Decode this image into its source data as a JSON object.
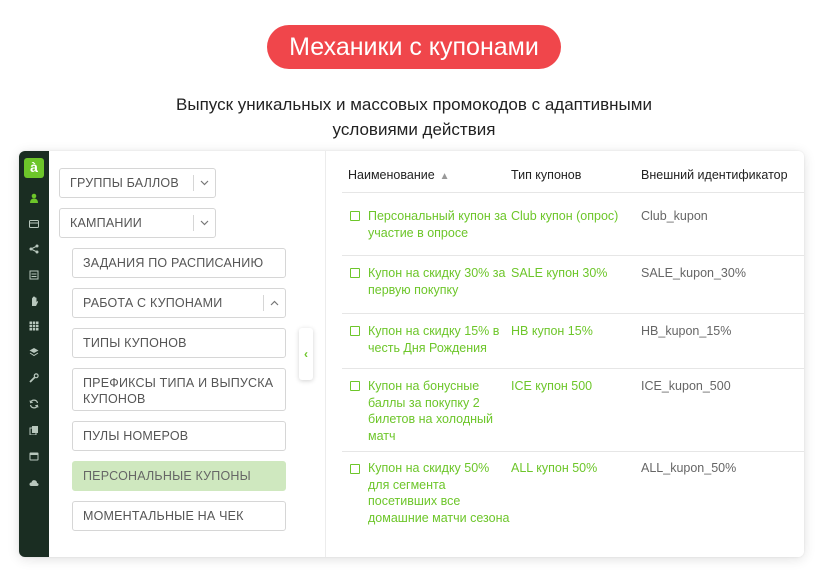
{
  "header": {
    "title": "Механики с купонами",
    "subtitle_line1": "Выпуск уникальных и массовых промокодов с адаптивными",
    "subtitle_line2": "условиями действия",
    "accent_color": "#f0464b"
  },
  "app": {
    "logo_letter": "à",
    "brand_color": "#6dc62a",
    "rail_icons": [
      "user-icon",
      "card-icon",
      "share-icon",
      "list-icon",
      "hand-icon",
      "grid-icon",
      "layers-icon",
      "wrench-icon",
      "sync-icon",
      "copy-icon",
      "calendar-icon",
      "cloud-icon"
    ]
  },
  "menu": {
    "items": [
      {
        "label": "ГРУППЫ БАЛЛОВ",
        "chevron": "down"
      },
      {
        "label": "КАМПАНИИ",
        "chevron": "down"
      },
      {
        "label": "ЗАДАНИЯ ПО РАСПИСАНИЮ"
      },
      {
        "label": "РАБОТА С КУПОНАМИ",
        "chevron": "up"
      },
      {
        "label": "ТИПЫ КУПОНОВ"
      },
      {
        "label": "ПРЕФИКСЫ ТИПА И ВЫПУСКА КУПОНОВ"
      },
      {
        "label": "ПУЛЫ НОМЕРОВ"
      },
      {
        "label": "ПЕРСОНАЛЬНЫЕ КУПОНЫ",
        "selected": true
      },
      {
        "label": "МОМЕНТАЛЬНЫЕ НА ЧЕК"
      }
    ]
  },
  "table": {
    "columns": [
      "Наименование",
      "Тип купонов",
      "Внешний идентификатор"
    ],
    "sorted_column": "Наименование",
    "sort_direction": "ascending",
    "rows": [
      {
        "name": "Персональный купон за участие в опросе",
        "type": "Club купон (опрос)",
        "external_id": "Club_kupon"
      },
      {
        "name": "Купон на скидку 30% за первую покупку",
        "type": "SALE купон 30%",
        "external_id": "SALE_kupon_30%"
      },
      {
        "name": "Купон на скидку 15% в честь Дня Рождения",
        "type": "HB купон 15%",
        "external_id": "HB_kupon_15%"
      },
      {
        "name": "Купон на бонусные баллы за покупку 2 билетов на холодный матч",
        "type": "ICE купон 500",
        "external_id": "ICE_kupon_500"
      },
      {
        "name": "Купон на скидку 50% для сегмента посетивших все домашние матчи сезона",
        "type": "ALL купон 50%",
        "external_id": "ALL_kupon_50%"
      }
    ]
  }
}
